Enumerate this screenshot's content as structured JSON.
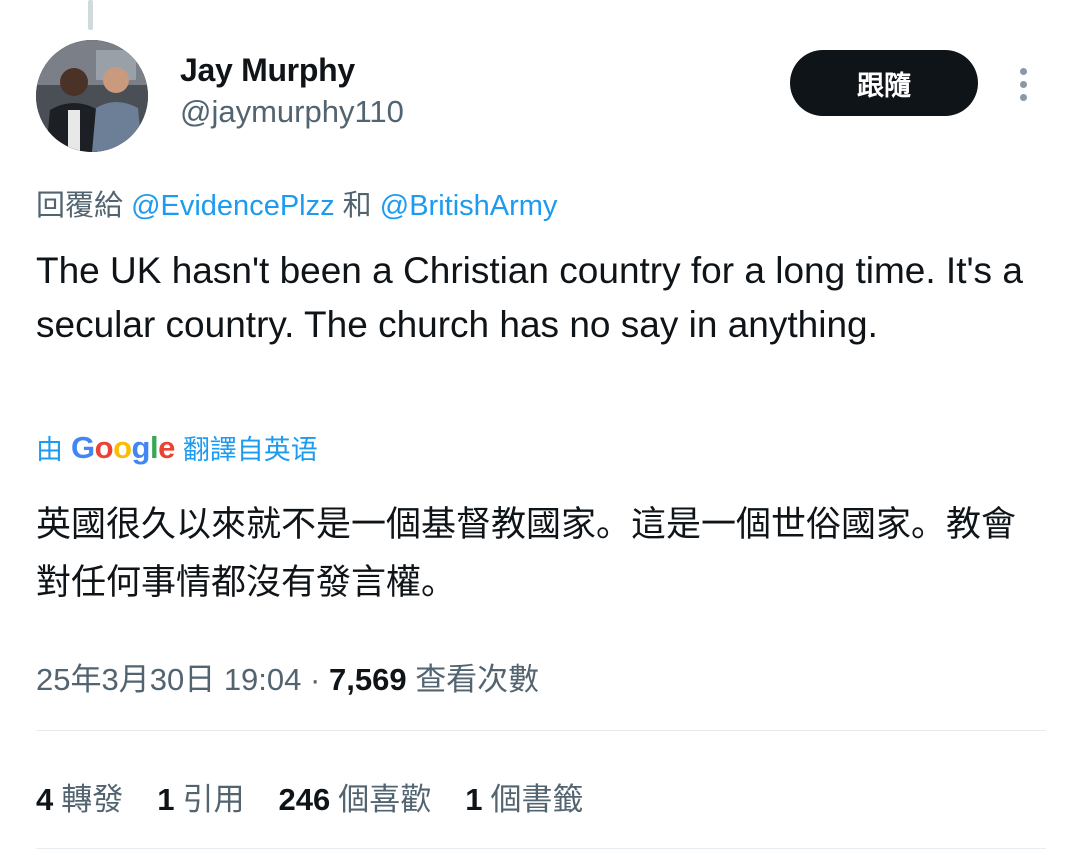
{
  "author": {
    "name": "Jay Murphy",
    "handle": "@jaymurphy110"
  },
  "follow_button_label": "跟隨",
  "reply": {
    "prefix": "回覆給",
    "mention1": "@EvidencePlzz",
    "conjunction": "和",
    "mention2": "@BritishArmy"
  },
  "tweet_text": "The UK hasn't been a Christian country for a long time. It's a secular country. The church has no say in anything.",
  "translation": {
    "by": "由",
    "google": [
      "G",
      "o",
      "o",
      "g",
      "l",
      "e"
    ],
    "suffix": "翻譯自英语",
    "text": "英國很久以來就不是一個基督教國家。這是一個世俗國家。教會對任何事情都沒有發言權。"
  },
  "meta": {
    "timestamp": "25年3月30日 19:04",
    "separator": "·",
    "views_count": "7,569",
    "views_label": "查看次數"
  },
  "stats": {
    "reposts_count": "4",
    "reposts_label": "轉發",
    "quotes_count": "1",
    "quotes_label": "引用",
    "likes_count": "246",
    "likes_label": "個喜歡",
    "bookmarks_count": "1",
    "bookmarks_label": "個書籤"
  },
  "icons": {
    "more": "more-vertical-icon"
  },
  "colors": {
    "link": "#1d9bf0",
    "secondary_text": "#536471",
    "primary_text": "#0f1419",
    "follow_button_bg": "#0f1419"
  }
}
